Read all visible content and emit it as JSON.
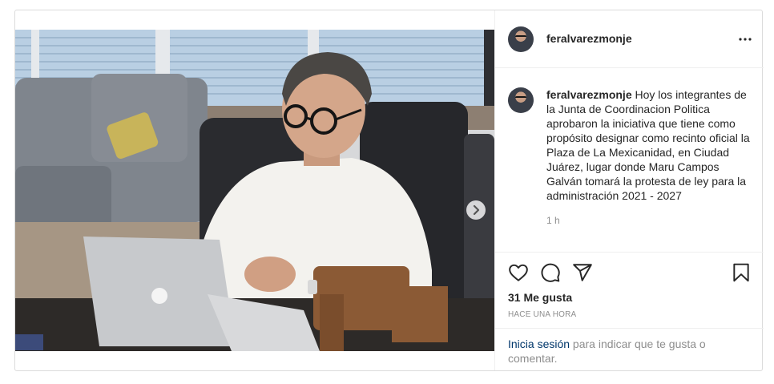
{
  "post": {
    "username": "feralvarezmonje",
    "caption": "Hoy los integrantes de la Junta de Coordinacion Politica aprobaron la iniciativa que tiene como propósito designar como recinto oficial la Plaza de La Mexicanidad, en Ciudad Juárez, lugar donde Maru Campos Galván tomará la protesta de ley para la administración 2021 - 2027",
    "time": "1 h",
    "likes": "31 Me gusta",
    "posted_ago": "HACE UNA HORA"
  },
  "login": {
    "link": "Inicia sesión",
    "text": " para indicar que te gusta o comentar."
  },
  "icons": [
    "more-options-icon",
    "chevron-right-icon",
    "heart-icon",
    "comment-icon",
    "share-icon",
    "bookmark-icon"
  ],
  "colors": {
    "link": "#00376b",
    "muted": "#8e8e8e",
    "text": "#262626",
    "border": "#dbdbdb"
  }
}
